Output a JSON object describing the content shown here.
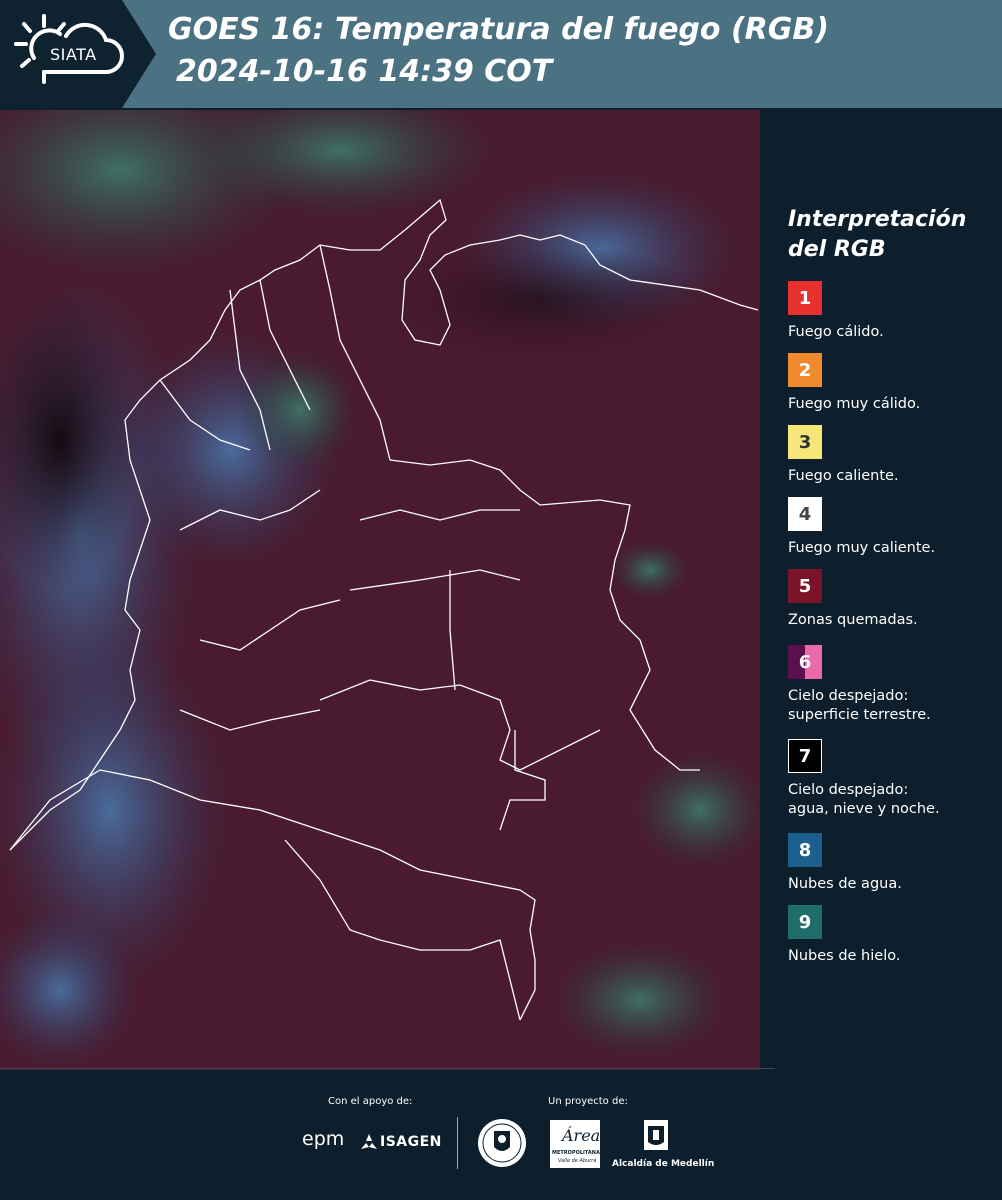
{
  "header": {
    "logo_text": "SIATA",
    "title_line1": "GOES 16: Temperatura del fuego (RGB)",
    "title_line2": "2024-10-16 14:39 COT",
    "colors": {
      "band": "#4b7282",
      "logo_bg": "#0f2230"
    }
  },
  "legend": {
    "title_line1": "Interpretación",
    "title_line2": "del RGB",
    "items": [
      {
        "num": "1",
        "label": "Fuego cálido.",
        "color": "#e8302f",
        "text_color": "#ffffff"
      },
      {
        "num": "2",
        "label": "Fuego muy cálido.",
        "color": "#f08a2e",
        "text_color": "#ffffff"
      },
      {
        "num": "3",
        "label": "Fuego caliente.",
        "color": "#f6e67a",
        "text_color": "#333333"
      },
      {
        "num": "4",
        "label": "Fuego muy caliente.",
        "color": "#ffffff",
        "text_color": "#444444"
      },
      {
        "num": "5",
        "label": "Zonas quemadas.",
        "color": "#7a1428",
        "text_color": "#ffffff"
      },
      {
        "num": "6",
        "label_line1": "Cielo despejado:",
        "label_line2": "superficie terrestre.",
        "color": "#5a0f4f",
        "color2": "#e86aa8",
        "text_color": "#ffffff"
      },
      {
        "num": "7",
        "label_line1": "Cielo despejado:",
        "label_line2": "agua, nieve y noche.",
        "color": "#000000",
        "text_color": "#ffffff"
      },
      {
        "num": "8",
        "label": "Nubes de agua.",
        "color": "#1c5f8f",
        "text_color": "#ffffff"
      },
      {
        "num": "9",
        "label": "Nubes de hielo.",
        "color": "#1e6e6c",
        "text_color": "#ffffff"
      }
    ]
  },
  "footer": {
    "support_label": "Con el apoyo de:",
    "project_label": "Un proyecto de:",
    "epm": "epm",
    "isagen": "ISAGEN",
    "metropolitana_line1": "Área",
    "metropolitana_line2": "METROPOLITANA",
    "metropolitana_line3": "Valle de Aburrá",
    "alcaldia": "Alcaldía de Medellín"
  }
}
